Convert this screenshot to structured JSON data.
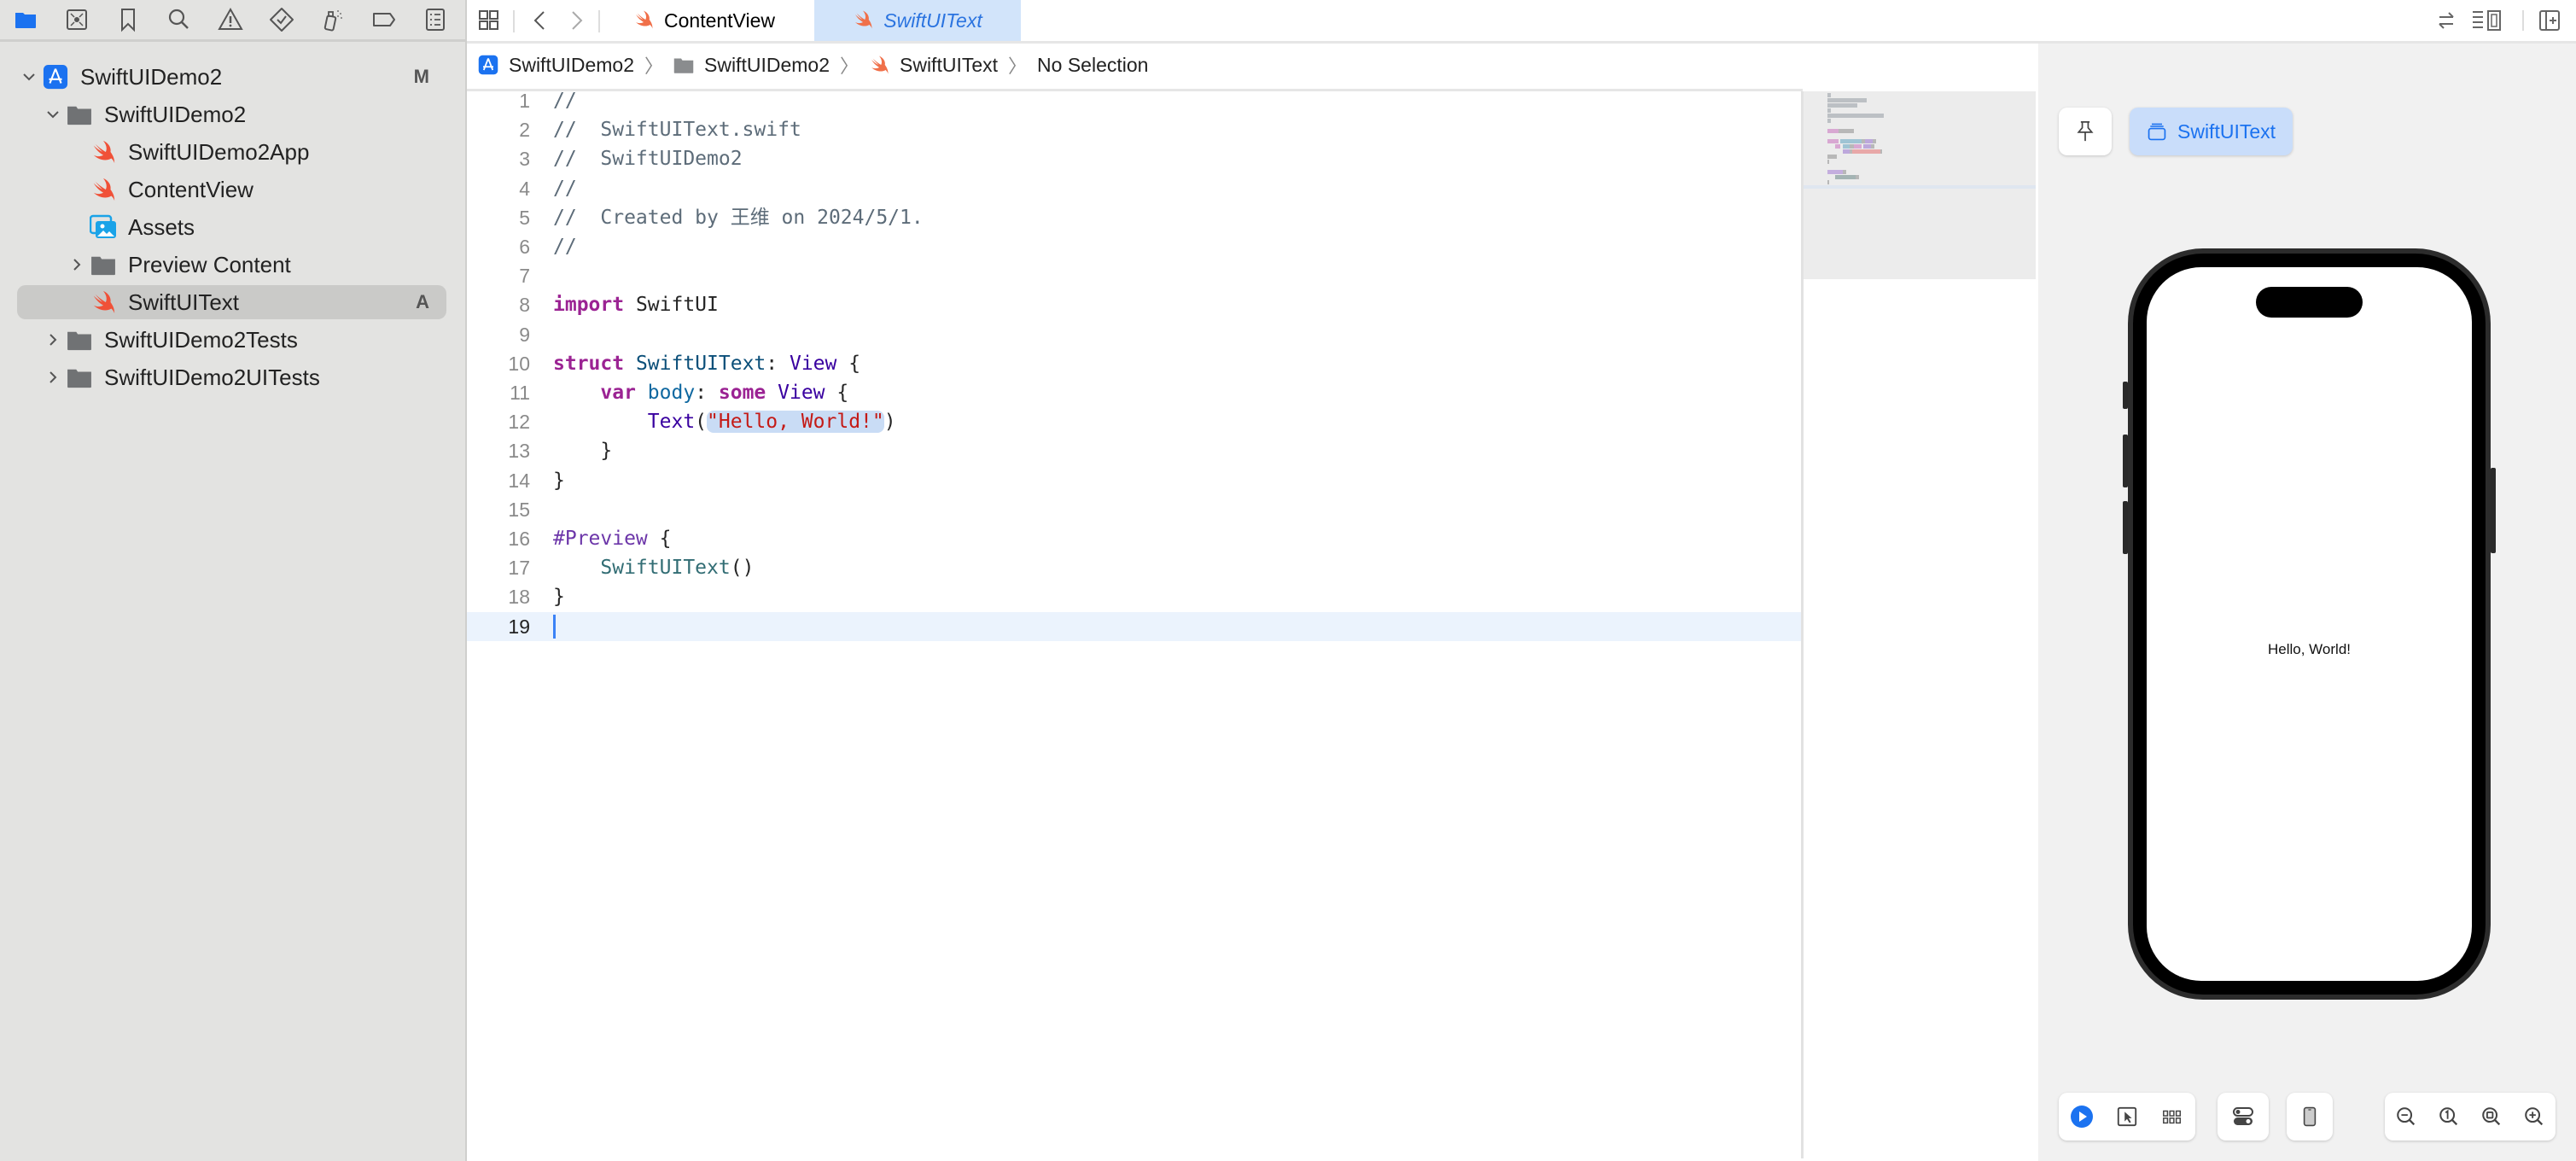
{
  "navigator_toolbar": {
    "icons": [
      {
        "name": "project-navigator-icon",
        "active": true
      },
      {
        "name": "source-control-icon"
      },
      {
        "name": "bookmark-icon"
      },
      {
        "name": "find-icon"
      },
      {
        "name": "issue-warning-icon"
      },
      {
        "name": "test-navigator-icon"
      },
      {
        "name": "debug-navigator-icon"
      },
      {
        "name": "breakpoint-icon"
      },
      {
        "name": "report-navigator-icon"
      }
    ]
  },
  "project_tree": [
    {
      "label": "SwiftUIDemo2",
      "type": "project",
      "expanded": true,
      "badge": "M",
      "level": 0
    },
    {
      "label": "SwiftUIDemo2",
      "type": "folder",
      "expanded": true,
      "level": 1
    },
    {
      "label": "SwiftUIDemo2App",
      "type": "swift",
      "level": 2
    },
    {
      "label": "ContentView",
      "type": "swift",
      "level": 2
    },
    {
      "label": "Assets",
      "type": "assets",
      "level": 2
    },
    {
      "label": "Preview Content",
      "type": "folder",
      "expanded": false,
      "level": 2
    },
    {
      "label": "SwiftUIText",
      "type": "swift",
      "level": 2,
      "selected": true,
      "badge": "A"
    },
    {
      "label": "SwiftUIDemo2Tests",
      "type": "folder",
      "expanded": false,
      "level": 1
    },
    {
      "label": "SwiftUIDemo2UITests",
      "type": "folder",
      "expanded": false,
      "level": 1
    }
  ],
  "tabs": [
    {
      "label": "ContentView",
      "active": false
    },
    {
      "label": "SwiftUIText",
      "active": true
    }
  ],
  "breadcrumb": {
    "items": [
      "SwiftUIDemo2",
      "SwiftUIDemo2",
      "SwiftUIText",
      "No Selection"
    ]
  },
  "editor": {
    "current_line": 19,
    "lines": [
      {
        "n": "1",
        "tokens": [
          {
            "t": "//",
            "c": "cm"
          }
        ]
      },
      {
        "n": "2",
        "tokens": [
          {
            "t": "//  SwiftUIText.swift",
            "c": "cm"
          }
        ]
      },
      {
        "n": "3",
        "tokens": [
          {
            "t": "//  SwiftUIDemo2",
            "c": "cm"
          }
        ]
      },
      {
        "n": "4",
        "tokens": [
          {
            "t": "//",
            "c": "cm"
          }
        ]
      },
      {
        "n": "5",
        "tokens": [
          {
            "t": "//  Created by 王维 on 2024/5/1.",
            "c": "cm"
          }
        ]
      },
      {
        "n": "6",
        "tokens": [
          {
            "t": "//",
            "c": "cm"
          }
        ]
      },
      {
        "n": "7",
        "tokens": []
      },
      {
        "n": "8",
        "tokens": [
          {
            "t": "import",
            "c": "kw"
          },
          {
            "t": " SwiftUI",
            "c": ""
          }
        ]
      },
      {
        "n": "9",
        "tokens": []
      },
      {
        "n": "10",
        "tokens": [
          {
            "t": "struct",
            "c": "kw"
          },
          {
            "t": " ",
            "c": ""
          },
          {
            "t": "SwiftUIText",
            "c": "ty"
          },
          {
            "t": ": ",
            "c": ""
          },
          {
            "t": "View",
            "c": "tyv"
          },
          {
            "t": " {",
            "c": ""
          }
        ]
      },
      {
        "n": "11",
        "tokens": [
          {
            "t": "    ",
            "c": ""
          },
          {
            "t": "var",
            "c": "kw"
          },
          {
            "t": " ",
            "c": ""
          },
          {
            "t": "body",
            "c": "prop"
          },
          {
            "t": ": ",
            "c": ""
          },
          {
            "t": "some",
            "c": "kw"
          },
          {
            "t": " ",
            "c": ""
          },
          {
            "t": "View",
            "c": "tyv"
          },
          {
            "t": " {",
            "c": ""
          }
        ]
      },
      {
        "n": "12",
        "tokens": [
          {
            "t": "        ",
            "c": ""
          },
          {
            "t": "Text",
            "c": "tyv"
          },
          {
            "t": "(",
            "c": ""
          },
          {
            "t": "\"Hello, World!\"",
            "c": "str"
          },
          {
            "t": ")",
            "c": ""
          }
        ]
      },
      {
        "n": "13",
        "tokens": [
          {
            "t": "    }",
            "c": ""
          }
        ]
      },
      {
        "n": "14",
        "tokens": [
          {
            "t": "}",
            "c": ""
          }
        ]
      },
      {
        "n": "15",
        "tokens": []
      },
      {
        "n": "16",
        "tokens": [
          {
            "t": "#Preview",
            "c": "macro"
          },
          {
            "t": " {",
            "c": ""
          }
        ]
      },
      {
        "n": "17",
        "tokens": [
          {
            "t": "    ",
            "c": ""
          },
          {
            "t": "SwiftUIText",
            "c": "fn"
          },
          {
            "t": "()",
            "c": ""
          }
        ]
      },
      {
        "n": "18",
        "tokens": [
          {
            "t": "}",
            "c": ""
          }
        ]
      },
      {
        "n": "19",
        "tokens": []
      }
    ]
  },
  "preview": {
    "variant_label": "SwiftUIText",
    "device_text": "Hello, World!",
    "bottom_toolbar": {
      "mode_buttons": [
        "live-preview-icon",
        "selectable-icon",
        "variants-grid-icon"
      ],
      "settings_button": "device-settings-icon",
      "device_button": "device-icon",
      "zoom_buttons": [
        "zoom-out-icon",
        "zoom-actual-size-icon",
        "zoom-to-fit-icon",
        "zoom-in-icon"
      ]
    }
  },
  "colors": {
    "accent": "#1b72f0",
    "swift_orange": "#f05138",
    "sidebar_bg": "#e3e3e1",
    "selected_row": "#cacac8",
    "active_tab_bg": "#d2e4fa",
    "string": "#c41a16",
    "keyword": "#9b2393"
  }
}
